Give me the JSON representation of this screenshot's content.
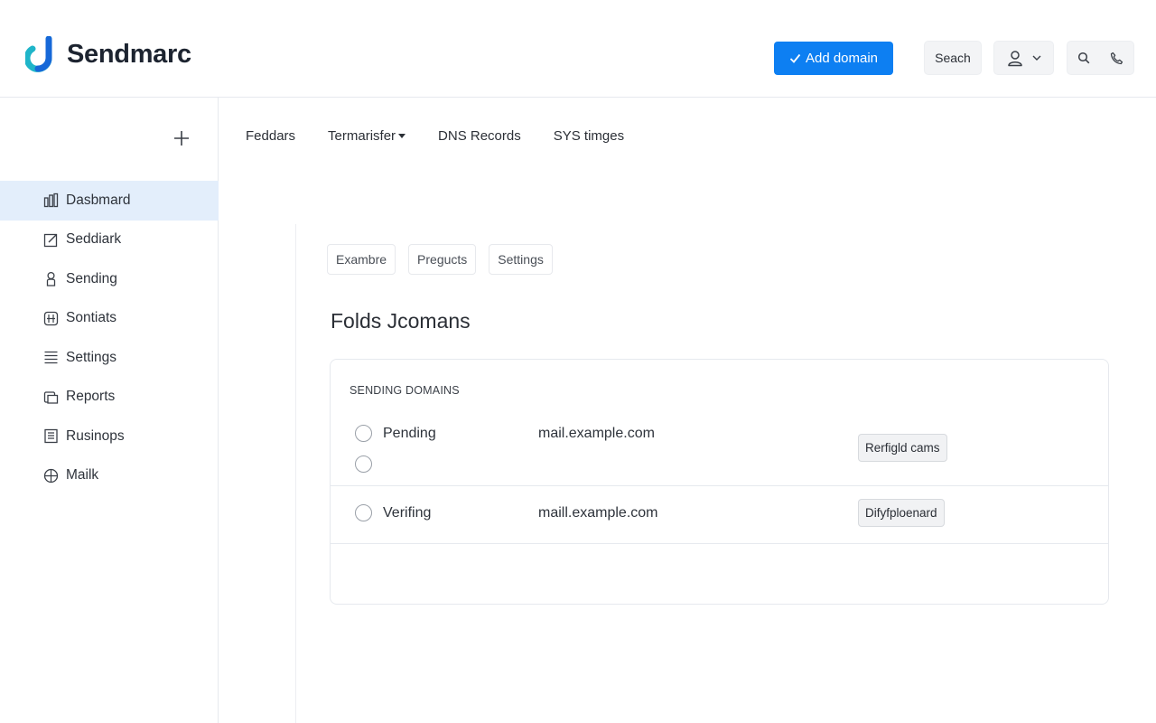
{
  "header": {
    "brand": "Sendmarc",
    "add_domain_label": "Add domain",
    "search_label": "Seach",
    "icons": {
      "logo": "sendmarc-logo-icon",
      "check": "check-icon",
      "user": "user-icon",
      "chevron": "chevron-down-icon",
      "search": "search-icon",
      "phone": "phone-icon"
    },
    "colors": {
      "primary": "#0d7ff2",
      "logo_teal": "#1fb5c9",
      "logo_blue": "#1668d8"
    }
  },
  "sidebar": {
    "add_icon": "plus-icon",
    "items": [
      {
        "label": "Dasbmard",
        "icon": "dashboard-icon",
        "active": true
      },
      {
        "label": "Seddiark",
        "icon": "edit-icon",
        "active": false
      },
      {
        "label": "Sending",
        "icon": "user-icon",
        "active": false
      },
      {
        "label": "Sontiats",
        "icon": "grid-icon",
        "active": false
      },
      {
        "label": "Settings",
        "icon": "list-icon",
        "active": false
      },
      {
        "label": "Reports",
        "icon": "report-icon",
        "active": false
      },
      {
        "label": "Rusinops",
        "icon": "document-icon",
        "active": false
      },
      {
        "label": "Mailk",
        "icon": "globe-icon",
        "active": false
      }
    ]
  },
  "top_tabs": [
    {
      "label": "Feddars"
    },
    {
      "label": "Termarisfer",
      "has_dropdown": true
    },
    {
      "label": "DNS Records"
    },
    {
      "label": "SYS timges"
    }
  ],
  "sub_tabs": [
    {
      "label": "Exambre"
    },
    {
      "label": "Pregucts"
    },
    {
      "label": "Settings"
    }
  ],
  "main": {
    "title": "Folds Jcomans",
    "section_label": "SENDING DOMAINS",
    "rows": [
      {
        "status": "Pending",
        "domain": "mail.example.com",
        "action": "Rerfigld cams"
      },
      {
        "status": "Verifing",
        "domain": "maill.example.com",
        "action": "Difyfploenard"
      }
    ]
  }
}
